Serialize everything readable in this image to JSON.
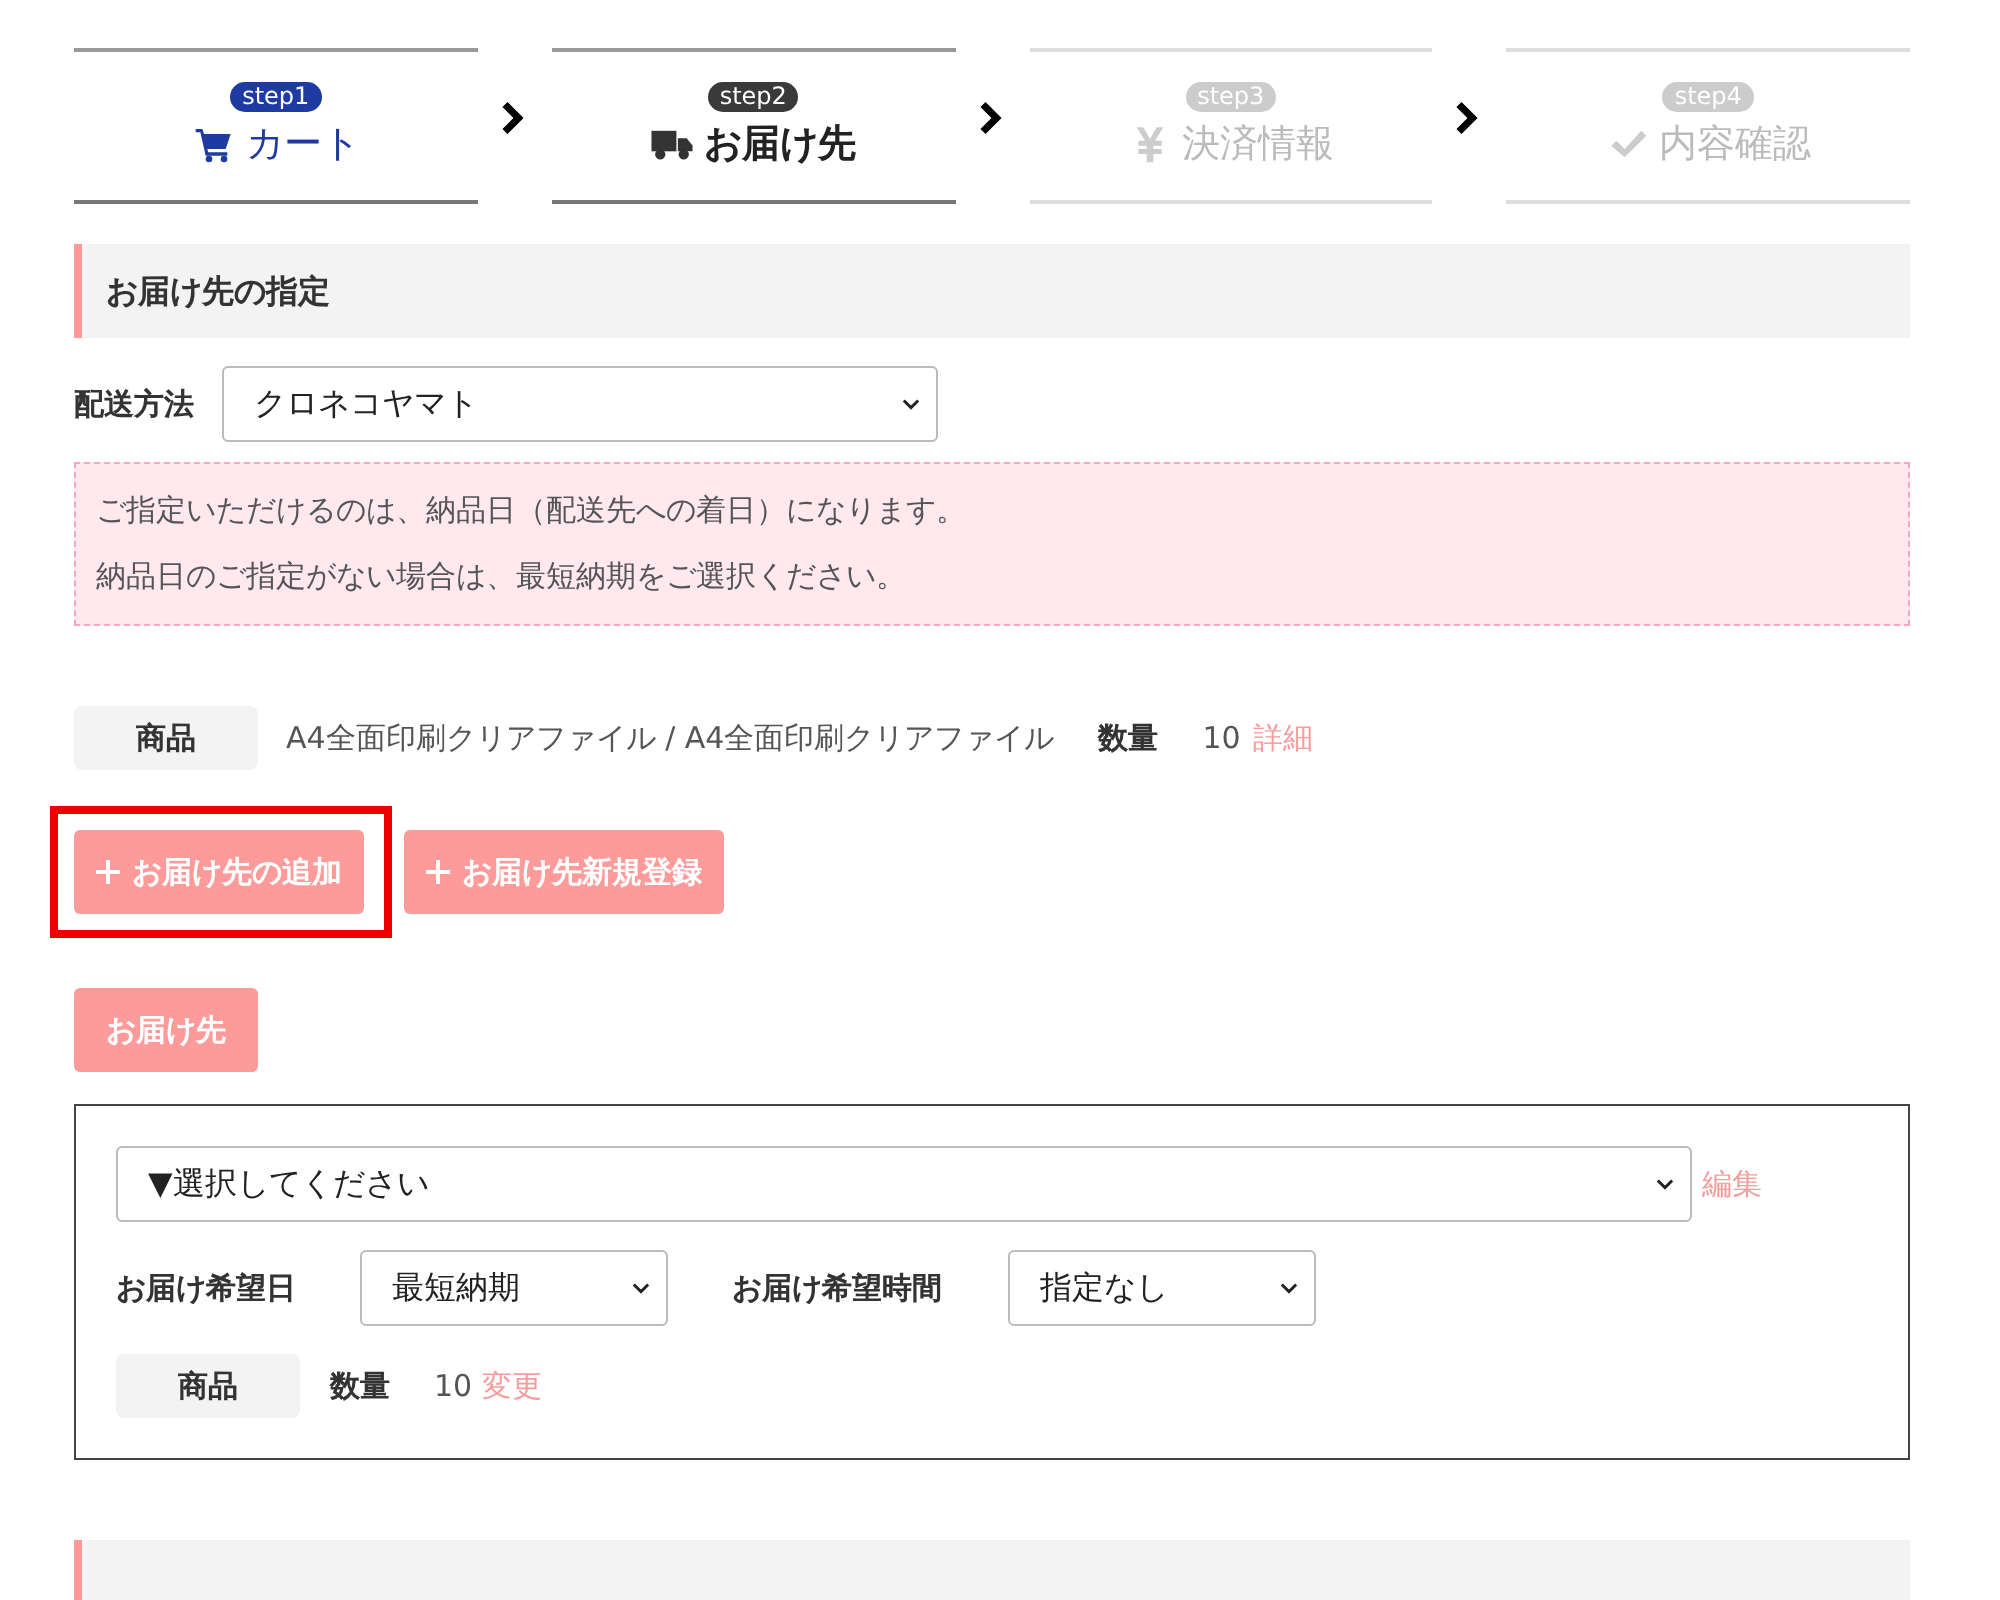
{
  "steps": [
    {
      "badge": "step1",
      "label": "カート",
      "kind": "cart",
      "selected": false,
      "completed": true
    },
    {
      "badge": "step2",
      "label": "お届け先",
      "kind": "truck",
      "selected": true,
      "completed": false
    },
    {
      "badge": "step3",
      "label": "決済情報",
      "kind": "yen",
      "selected": false,
      "completed": false
    },
    {
      "badge": "step4",
      "label": "内容確認",
      "kind": "check",
      "selected": false,
      "completed": false
    }
  ],
  "section_title": "お届け先の指定",
  "shipping_method": {
    "label": "配送方法",
    "value": "クロネコヤマト"
  },
  "notice": [
    "ご指定いただけるのは、納品日（配送先への着日）になります。",
    "納品日のご指定がない場合は、最短納期をご選択ください。"
  ],
  "product_row": {
    "label": "商品",
    "name": "A4全面印刷クリアファイル / A4全面印刷クリアファイル",
    "qty_label": "数量",
    "qty": "10",
    "link": "詳細"
  },
  "actions": [
    {
      "label": "お届け先の追加",
      "highlighted": true
    },
    {
      "label": "お届け先新規登録",
      "highlighted": false
    }
  ],
  "destination_tab": "お届け先",
  "destination": {
    "address": {
      "value": "▼選択してください",
      "link": "編集"
    },
    "date": {
      "label": "お届け希望日",
      "value": "最短納期"
    },
    "time": {
      "label": "お届け希望時間",
      "value": "指定なし"
    },
    "product": {
      "label": "商品",
      "qty_label": "数量",
      "qty": "10",
      "link": "変更"
    }
  }
}
